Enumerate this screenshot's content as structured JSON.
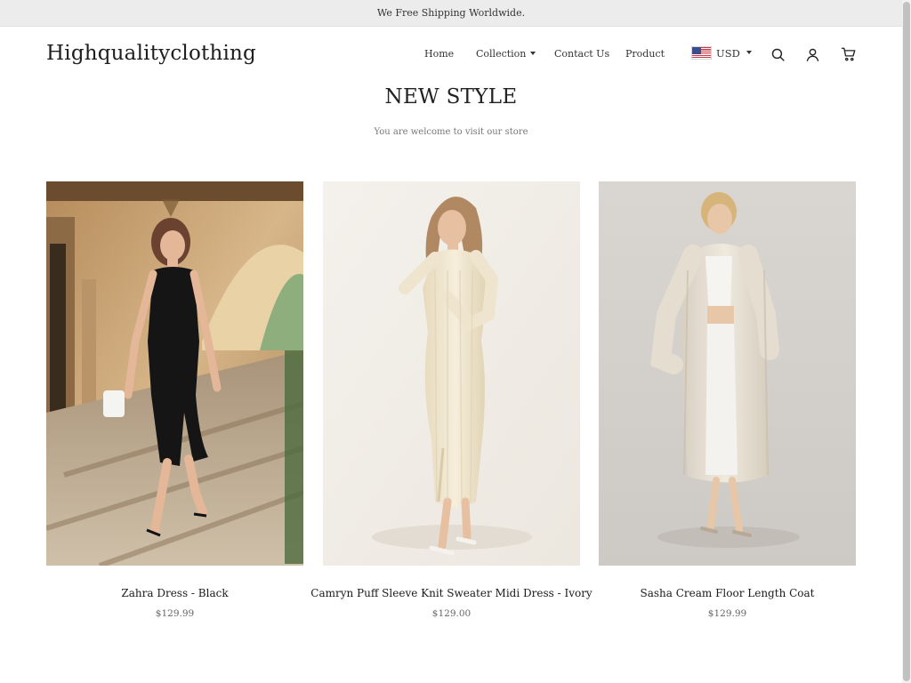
{
  "announcement": "We Free Shipping Worldwide.",
  "header": {
    "logo": "Highqualityclothing",
    "nav": [
      {
        "label": "Home"
      },
      {
        "label": "Collection"
      },
      {
        "label": "Contact Us"
      },
      {
        "label": "Product"
      }
    ],
    "currency": "USD"
  },
  "section": {
    "title": "NEW STYLE",
    "subtitle": "You are welcome to visit our store"
  },
  "products": [
    {
      "name": "Zahra Dress - Black",
      "price": "$129.99"
    },
    {
      "name": "Camryn Puff Sleeve Knit Sweater Midi Dress - Ivory",
      "price": "$129.00"
    },
    {
      "name": "Sasha Cream Floor Length Coat",
      "price": "$129.99"
    }
  ],
  "colors": {
    "announce_bg": "#ececec",
    "text": "#222222",
    "muted": "#777777"
  }
}
